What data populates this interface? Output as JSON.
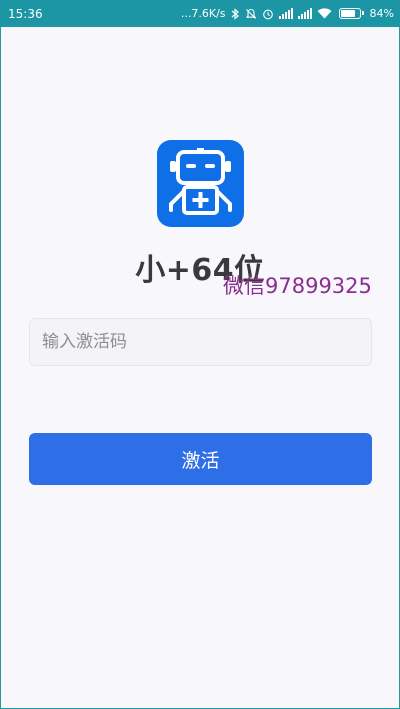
{
  "status_bar": {
    "time": "15:36",
    "net_speed": "...7.6K/s",
    "battery_percent": "84%",
    "battery_level": 0.84,
    "icons": [
      "bluetooth-icon",
      "mute-icon",
      "alarm-icon",
      "signal-icon",
      "signal-icon",
      "wifi-icon",
      "battery-icon"
    ]
  },
  "app": {
    "logo_icon": "robot-plus-icon",
    "title": "小+64位",
    "watermark": "微信97899325",
    "activation_input": {
      "value": "",
      "placeholder": "输入激活码"
    },
    "activate_button_label": "激活"
  },
  "colors": {
    "accent": "#2e6ee7",
    "logo_bg": "#0f6fe6",
    "watermark": "#8a2e90",
    "background": "#f8f7fb"
  }
}
